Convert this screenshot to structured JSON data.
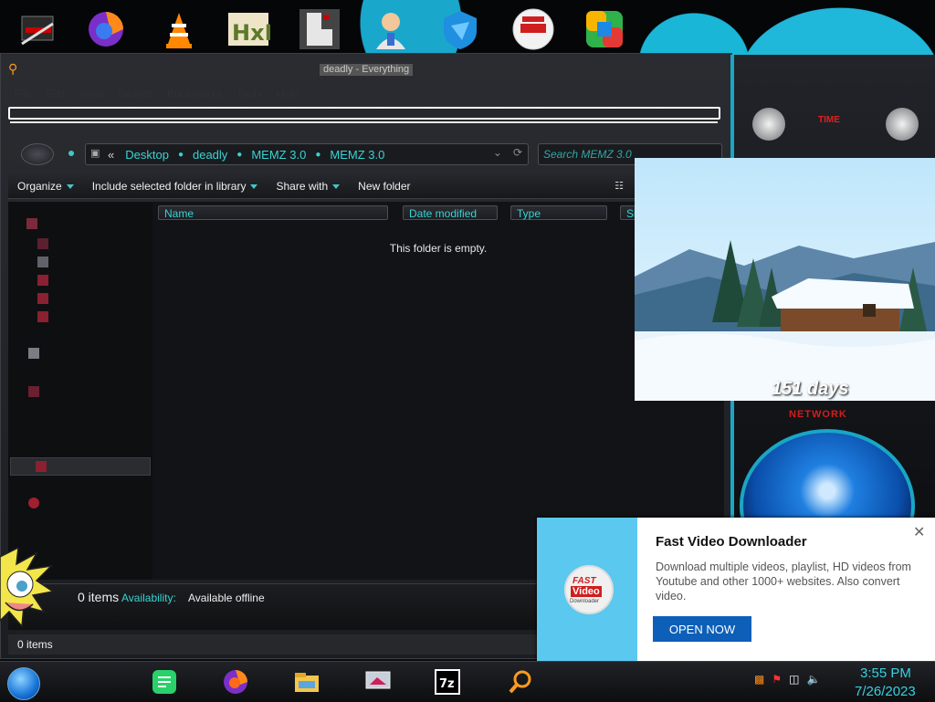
{
  "explorer": {
    "title": "deadly - Everything",
    "menu": [
      "File",
      "Edit",
      "View",
      "Search",
      "Bookmarks",
      "Tools",
      "Help"
    ],
    "address": {
      "overflow": "«",
      "crumbs": [
        "Desktop",
        "deadly",
        "MEMZ 3.0",
        "MEMZ 3.0"
      ]
    },
    "search_placeholder": "Search MEMZ 3.0",
    "toolbar": {
      "organize": "Organize",
      "include_library": "Include selected folder in library",
      "share_with": "Share with",
      "new_folder": "New folder"
    },
    "columns": {
      "name": "Name",
      "date": "Date modified",
      "type": "Type",
      "size": "Si"
    },
    "empty_message": "This folder is empty.",
    "details": {
      "count": "0 items",
      "availability_label": "Availability:",
      "availability_value": "Available offline"
    },
    "status": "0 items"
  },
  "picture": {
    "days": "151 days"
  },
  "gadget": {
    "network_label": "NETWORK",
    "label_time": "TIME"
  },
  "toast": {
    "title": "Fast Video Downloader",
    "body": "Download multiple videos, playlist, HD videos from Youtube and other 1000+ websites. Also convert video.",
    "cta": "OPEN NOW",
    "logo_line1": "FAST",
    "logo_line2": "Video",
    "logo_line3": "Downloader"
  },
  "desktop_icons": [
    "toolbox-icon",
    "firefox-icon",
    "vlc-icon",
    "hxd-icon",
    "app-icon",
    "doctor-icon",
    "shield-icon",
    "fast-video-downloader-icon",
    "app-square-icon"
  ],
  "clock": {
    "time": "3:55 PM",
    "date": "7/26/2023"
  },
  "colors": {
    "accent": "#37d4d4",
    "toast_blue": "#0d5fb8",
    "toast_panel": "#5bc8ef"
  }
}
